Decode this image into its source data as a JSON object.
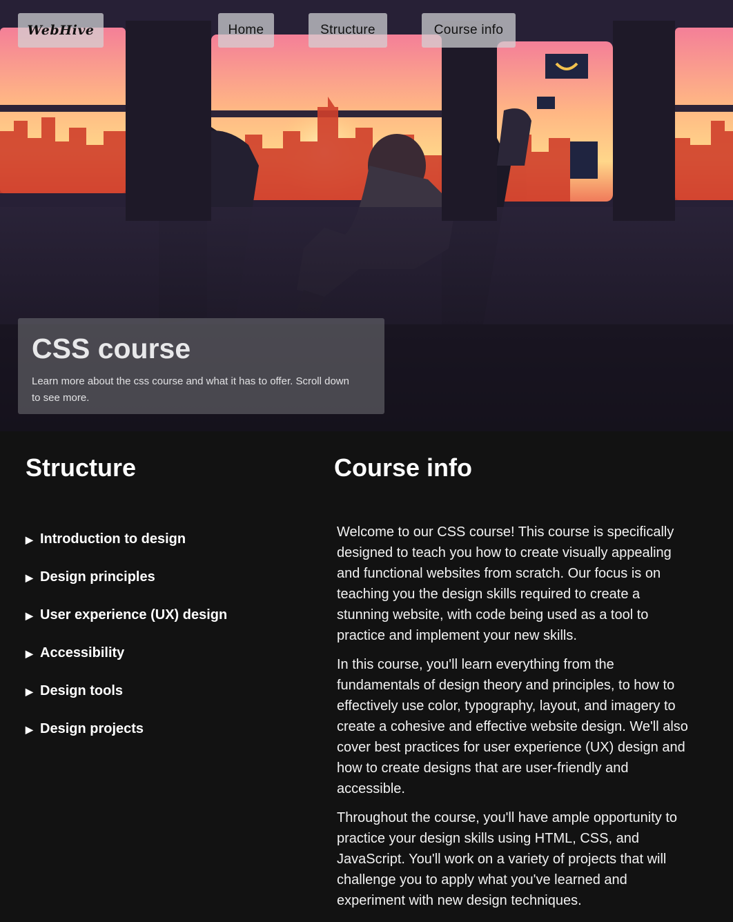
{
  "nav": {
    "logo": "WebHive",
    "links": [
      "Home",
      "Structure",
      "Course info"
    ]
  },
  "hero": {
    "title": "CSS course",
    "subtitle": "Learn more about the css course and what it has to offer. Scroll down to see more."
  },
  "structure": {
    "title": "Structure",
    "items": [
      "Introduction to design",
      "Design principles",
      "User experience (UX) design",
      "Accessibility",
      "Design tools",
      "Design projects"
    ]
  },
  "course_info": {
    "title": "Course info",
    "paragraphs": [
      "Welcome to our CSS course! This course is specifically designed to teach you how to create visually appealing and functional websites from scratch. Our focus is on teaching you the design skills required to create a stunning website, with code being used as a tool to practice and implement your new skills.",
      "In this course, you'll learn everything from the fundamentals of design theory and principles, to how to effectively use color, typography, layout, and imagery to create a cohesive and effective website design. We'll also cover best practices for user experience (UX) design and how to create designs that are user-friendly and accessible.",
      "Throughout the course, you'll have ample opportunity to practice your design skills using HTML, CSS, and JavaScript. You'll work on a variety of projects that will challenge you to apply what you've learned and experiment with new design techniques."
    ]
  },
  "colors": {
    "page_background": "#121212",
    "sunset_top": "#f58a9a",
    "sunset_glow": "#ffd07a",
    "city_silhouette": "#d6442e"
  }
}
